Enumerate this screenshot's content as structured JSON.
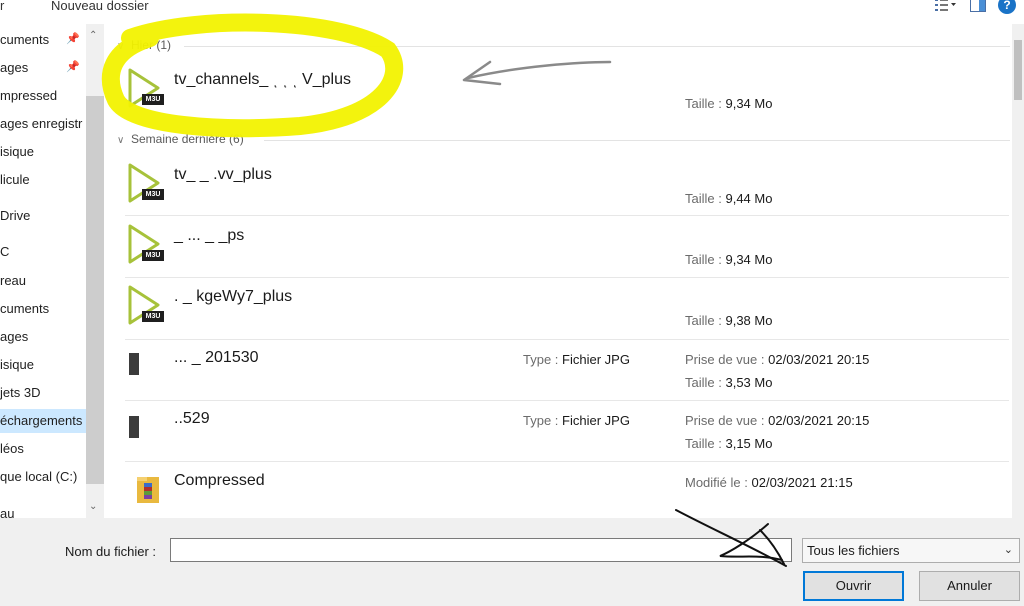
{
  "toolbar": {
    "left_label": "r",
    "new_folder_label": "Nouveau dossier",
    "help_label": "?"
  },
  "sidebar": {
    "items": [
      {
        "label": "cuments",
        "pinned": true
      },
      {
        "label": "ages",
        "pinned": true
      },
      {
        "label": "mpressed",
        "pinned": false
      },
      {
        "label": "ages enregistr",
        "pinned": false
      },
      {
        "label": "isique",
        "pinned": false
      },
      {
        "label": "licule",
        "pinned": false
      },
      {
        "label": "Drive",
        "pinned": false
      },
      {
        "label": "C",
        "pinned": false
      },
      {
        "label": "reau",
        "pinned": false
      },
      {
        "label": "cuments",
        "pinned": false
      },
      {
        "label": "ages",
        "pinned": false
      },
      {
        "label": "isique",
        "pinned": false
      },
      {
        "label": "jets 3D",
        "pinned": false
      },
      {
        "label": "échargements",
        "pinned": false,
        "selected": true
      },
      {
        "label": "léos",
        "pinned": false
      },
      {
        "label": "que local (C:)",
        "pinned": false
      },
      {
        "label": "au",
        "pinned": false
      }
    ]
  },
  "groups": [
    {
      "label": "Hier (1)"
    },
    {
      "label": "Semaine dernière (6)"
    }
  ],
  "files": [
    {
      "name": "tv_channels_ ͺ ͺ ͺ  V_plus",
      "icon": "m3u-icon",
      "size_key": "Taille :",
      "size": "9,34 Mo"
    },
    {
      "name": "tv_                        _ .vv_plus",
      "icon": "m3u-icon",
      "size_key": "Taille :",
      "size": "9,44 Mo"
    },
    {
      "name": "                    _ ...   _ _ps",
      "icon": "m3u-icon",
      "size_key": "Taille :",
      "size": "9,34 Mo"
    },
    {
      "name": "    .        _ kgeWy7_plus",
      "icon": "m3u-icon",
      "size_key": "Taille :",
      "size": "9,38 Mo"
    },
    {
      "name": "            ...      _ 201530",
      "icon": "jpg-icon",
      "type_key": "Type :",
      "type": "Fichier JPG",
      "date_key": "Prise de vue :",
      "date": "02/03/2021 20:15",
      "size_key": "Taille :",
      "size": "3,53 Mo"
    },
    {
      "name": "                           ..529",
      "icon": "jpg-icon",
      "type_key": "Type :",
      "type": "Fichier JPG",
      "date_key": "Prise de vue :",
      "date": "02/03/2021 20:15",
      "size_key": "Taille :",
      "size": "3,15 Mo"
    },
    {
      "name": "Compressed",
      "icon": "folder-icon",
      "date_key": "Modifié le :",
      "date": "02/03/2021 21:15"
    }
  ],
  "badge_text": "M3U",
  "footer": {
    "filename_label": "Nom du fichier :",
    "filename_value": "",
    "filter_value": "Tous les fichiers",
    "open_label": "Ouvrir",
    "cancel_label": "Annuler"
  },
  "colors": {
    "highlight": "#f2f200",
    "accent": "#0078d7",
    "selection": "#cce8ff"
  }
}
